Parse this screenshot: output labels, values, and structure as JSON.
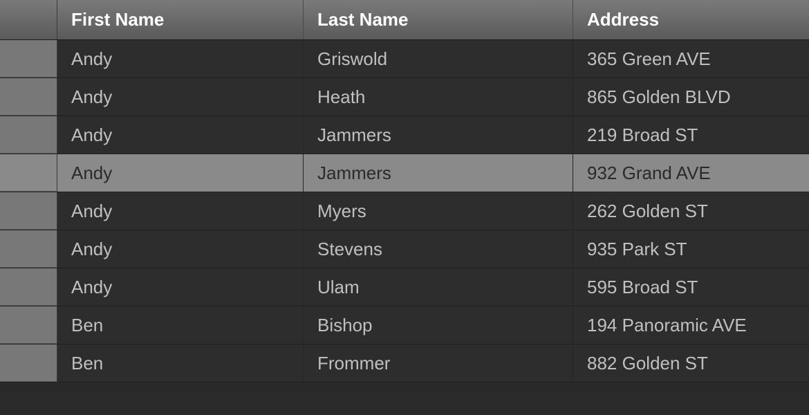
{
  "columns": {
    "first_name": "First Name",
    "last_name": "Last Name",
    "address": "Address"
  },
  "rows": [
    {
      "first_name": "Andy",
      "last_name": "Griswold",
      "address": "365 Green AVE",
      "selected": false
    },
    {
      "first_name": "Andy",
      "last_name": "Heath",
      "address": "865 Golden BLVD",
      "selected": false
    },
    {
      "first_name": "Andy",
      "last_name": "Jammers",
      "address": "219 Broad ST",
      "selected": false
    },
    {
      "first_name": "Andy",
      "last_name": "Jammers",
      "address": "932 Grand AVE",
      "selected": true
    },
    {
      "first_name": "Andy",
      "last_name": "Myers",
      "address": "262 Golden ST",
      "selected": false
    },
    {
      "first_name": "Andy",
      "last_name": "Stevens",
      "address": "935 Park ST",
      "selected": false
    },
    {
      "first_name": "Andy",
      "last_name": "Ulam",
      "address": "595 Broad ST",
      "selected": false
    },
    {
      "first_name": "Ben",
      "last_name": "Bishop",
      "address": "194 Panoramic AVE",
      "selected": false
    },
    {
      "first_name": "Ben",
      "last_name": "Frommer",
      "address": "882 Golden ST",
      "selected": false
    }
  ]
}
